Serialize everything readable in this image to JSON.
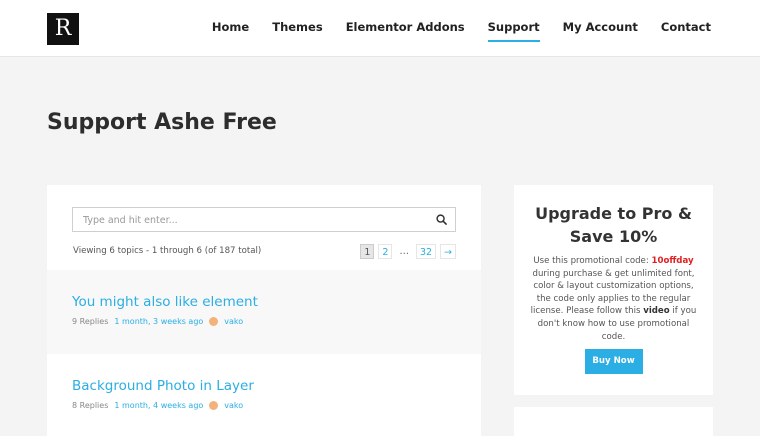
{
  "header": {
    "logo_letter": "R",
    "nav": [
      {
        "label": "Home"
      },
      {
        "label": "Themes"
      },
      {
        "label": "Elementor Addons"
      },
      {
        "label": "Support"
      },
      {
        "label": "My Account"
      },
      {
        "label": "Contact"
      }
    ],
    "active_nav": "Support"
  },
  "page_title": "Support Ashe Free",
  "search": {
    "placeholder": "Type and hit enter..."
  },
  "viewing_text": "Viewing 6 topics - 1 through 6 (of 187 total)",
  "pagination": {
    "current": "1",
    "p2": "2",
    "dots": "…",
    "last": "32",
    "next": "→"
  },
  "topics": [
    {
      "title": "You might also like element",
      "replies": "9 Replies",
      "time": "1 month, 3 weeks ago",
      "user": "vako"
    },
    {
      "title": "Background Photo in Layer",
      "replies": "8 Replies",
      "time": "1 month, 4 weeks ago",
      "user": "vako"
    }
  ],
  "promo": {
    "title": "Upgrade to Pro & Save 10%",
    "text_1": "Use this promotional code: ",
    "code": "10offday",
    "text_2": " during purchase & get unlimited font, color & layout customization options, the code only applies to the regular license. Please follow this ",
    "video": "video",
    "text_3": " if you don't know how to use promotional code.",
    "button": "Buy Now"
  },
  "colors": {
    "accent": "#2aaee3",
    "code_red": "#e02020",
    "page_bg": "#f4f4f4"
  }
}
